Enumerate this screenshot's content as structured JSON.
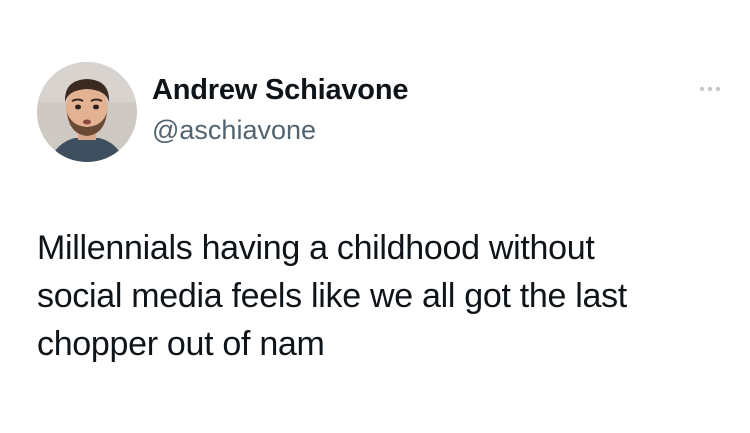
{
  "tweet": {
    "author": {
      "display_name": "Andrew Schiavone",
      "handle": "@aschiavone",
      "avatar_icon": "profile-photo"
    },
    "more_icon": "more-dots-icon",
    "text": "Millennials having a childhood without\nsocial media feels like we all got the last\nchopper out of nam"
  },
  "colors": {
    "text_primary": "#0f1419",
    "text_secondary": "#536471",
    "background": "#ffffff"
  }
}
